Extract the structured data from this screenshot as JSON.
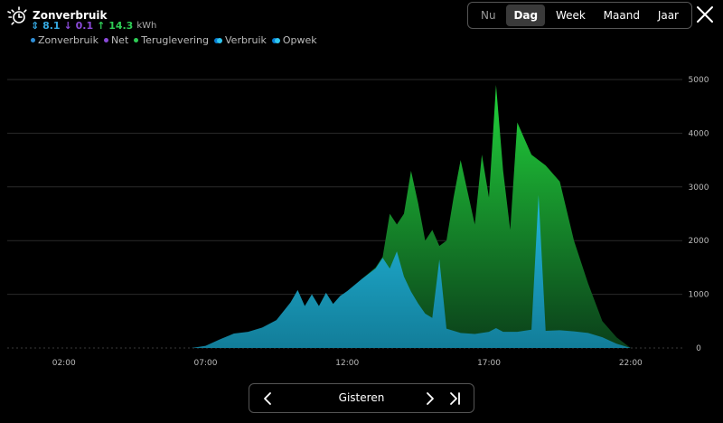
{
  "header": {
    "title": "Zonverbruik",
    "stats": [
      {
        "arrow": "⇕",
        "value": "8.1",
        "color": "#35a8e0"
      },
      {
        "arrow": "↓",
        "value": "0.1",
        "color": "#8a4ad8"
      },
      {
        "arrow": "↑",
        "value": "14.3",
        "color": "#2ecc55"
      }
    ],
    "unit": "kWh",
    "legend": [
      {
        "label": "Zonverbruik",
        "color": "#2f8fd8",
        "kind": "dot"
      },
      {
        "label": "Net",
        "color": "#8a4ad8",
        "kind": "dot"
      },
      {
        "label": "Teruglevering",
        "color": "#2ecc55",
        "kind": "dot"
      },
      {
        "label": "Verbruik",
        "color": "#2fc7f0",
        "kind": "ring"
      },
      {
        "label": "Opwek",
        "color": "#2fc7f0",
        "kind": "ring"
      }
    ]
  },
  "periods": [
    {
      "label": "Nu",
      "state": "muted"
    },
    {
      "label": "Dag",
      "state": "active"
    },
    {
      "label": "Week",
      "state": "normal"
    },
    {
      "label": "Maand",
      "state": "normal"
    },
    {
      "label": "Jaar",
      "state": "normal"
    }
  ],
  "navigation": {
    "label": "Gisteren"
  },
  "icons": {
    "title": "solar-clock-icon",
    "close": "close-icon",
    "prev": "chevron-left-icon",
    "next": "chevron-right-icon",
    "last": "skip-to-end-icon"
  },
  "colors": {
    "zonverbruik": "#1e9cc4",
    "teruglevering_top": "#21d43b",
    "teruglevering_bottom": "#0b3f1a",
    "net": "#8a4ad8",
    "grid": "#2a2a2a"
  },
  "chart_data": {
    "type": "area",
    "ylim": [
      0,
      5000
    ],
    "y_ticks": [
      0,
      1000,
      2000,
      3000,
      4000,
      5000
    ],
    "x_ticks": [
      "02:00",
      "07:00",
      "12:00",
      "17:00",
      "22:00"
    ],
    "x_range": [
      "00:00",
      "23:59"
    ],
    "series": [
      {
        "name": "Zonverbruik",
        "points": [
          [
            "06:30",
            0
          ],
          [
            "07:00",
            40
          ],
          [
            "07:30",
            160
          ],
          [
            "08:00",
            270
          ],
          [
            "08:30",
            300
          ],
          [
            "09:00",
            380
          ],
          [
            "09:30",
            520
          ],
          [
            "10:00",
            850
          ],
          [
            "10:15",
            1080
          ],
          [
            "10:30",
            780
          ],
          [
            "10:45",
            1000
          ],
          [
            "11:00",
            780
          ],
          [
            "11:15",
            1030
          ],
          [
            "11:30",
            820
          ],
          [
            "11:45",
            970
          ],
          [
            "12:00",
            1060
          ],
          [
            "12:30",
            1280
          ],
          [
            "13:00",
            1480
          ],
          [
            "13:15",
            1680
          ],
          [
            "13:30",
            1480
          ],
          [
            "13:45",
            1800
          ],
          [
            "14:00",
            1330
          ],
          [
            "14:15",
            1050
          ],
          [
            "14:30",
            830
          ],
          [
            "14:45",
            640
          ],
          [
            "15:00",
            560
          ],
          [
            "15:15",
            1650
          ],
          [
            "15:30",
            360
          ],
          [
            "16:00",
            280
          ],
          [
            "16:30",
            260
          ],
          [
            "17:00",
            300
          ],
          [
            "17:15",
            370
          ],
          [
            "17:30",
            300
          ],
          [
            "18:00",
            300
          ],
          [
            "18:30",
            340
          ],
          [
            "18:45",
            2850
          ],
          [
            "19:00",
            320
          ],
          [
            "19:30",
            330
          ],
          [
            "20:00",
            310
          ],
          [
            "20:30",
            280
          ],
          [
            "21:00",
            200
          ],
          [
            "21:30",
            80
          ],
          [
            "22:00",
            0
          ]
        ]
      },
      {
        "name": "Teruglevering",
        "points": [
          [
            "12:30",
            1280
          ],
          [
            "13:00",
            1500
          ],
          [
            "13:15",
            1700
          ],
          [
            "13:30",
            2500
          ],
          [
            "13:45",
            2300
          ],
          [
            "14:00",
            2500
          ],
          [
            "14:15",
            3300
          ],
          [
            "14:30",
            2700
          ],
          [
            "14:45",
            2000
          ],
          [
            "15:00",
            2200
          ],
          [
            "15:15",
            1900
          ],
          [
            "15:30",
            2000
          ],
          [
            "15:45",
            2800
          ],
          [
            "16:00",
            3500
          ],
          [
            "16:15",
            2900
          ],
          [
            "16:30",
            2300
          ],
          [
            "16:45",
            3600
          ],
          [
            "17:00",
            2800
          ],
          [
            "17:15",
            4900
          ],
          [
            "17:30",
            3300
          ],
          [
            "17:45",
            2200
          ],
          [
            "18:00",
            4200
          ],
          [
            "18:15",
            3900
          ],
          [
            "18:30",
            3600
          ],
          [
            "18:45",
            3500
          ],
          [
            "19:00",
            3400
          ],
          [
            "19:30",
            3100
          ],
          [
            "20:00",
            2000
          ],
          [
            "20:30",
            1200
          ],
          [
            "21:00",
            500
          ],
          [
            "21:30",
            200
          ],
          [
            "22:00",
            0
          ]
        ]
      }
    ]
  }
}
